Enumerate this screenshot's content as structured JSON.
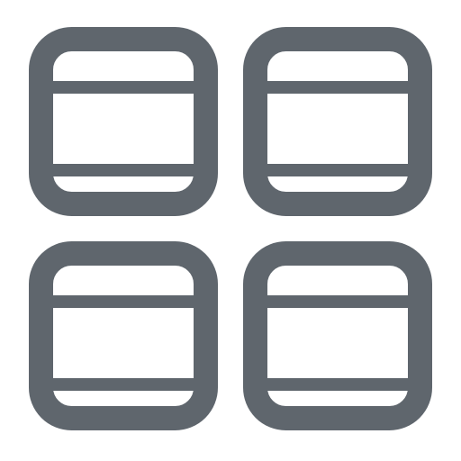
{
  "icon": {
    "name": "grid-view-icon",
    "color": "#5f666d",
    "tiles": [
      {
        "name": "tile-top-left"
      },
      {
        "name": "tile-top-right"
      },
      {
        "name": "tile-bottom-left"
      },
      {
        "name": "tile-bottom-right"
      }
    ]
  }
}
